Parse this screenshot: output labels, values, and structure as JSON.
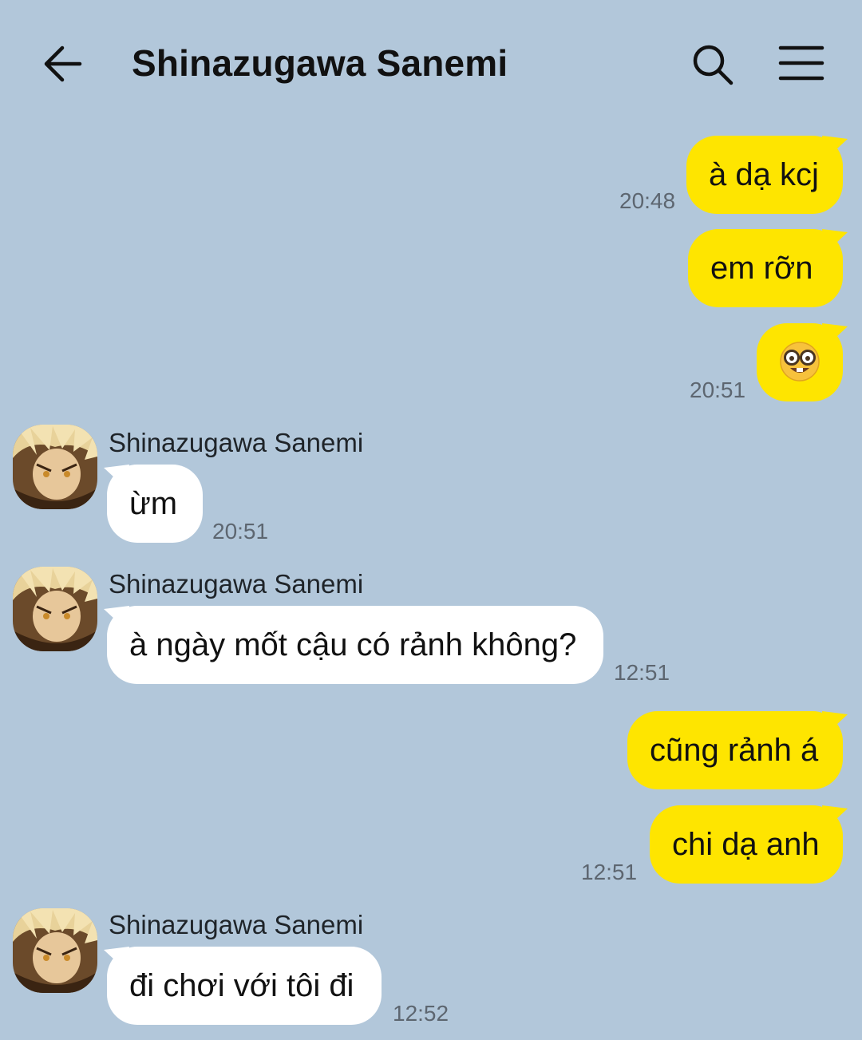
{
  "header": {
    "title": "Shinazugawa Sanemi",
    "back_icon": "arrow-left-icon",
    "search_icon": "search-icon",
    "menu_icon": "hamburger-menu-icon"
  },
  "colors": {
    "background": "#b2c7da",
    "my_bubble": "#fee500",
    "their_bubble": "#ffffff"
  },
  "messages": [
    {
      "text": "à dạ kcj",
      "time": "20:48"
    },
    {
      "text": "em rỡn"
    },
    {
      "text": "🤓",
      "time": "20:51"
    },
    {
      "sender": "Shinazugawa Sanemi",
      "text": "ừm",
      "time": "20:51"
    },
    {
      "sender": "Shinazugawa Sanemi",
      "text": "à ngày mốt cậu có rảnh không?",
      "time": "12:51"
    },
    {
      "text": "cũng rảnh á"
    },
    {
      "text": "chi dạ anh",
      "time": "12:51"
    },
    {
      "sender": "Shinazugawa Sanemi",
      "text": "đi chơi với tôi đi",
      "time": "12:52"
    }
  ]
}
